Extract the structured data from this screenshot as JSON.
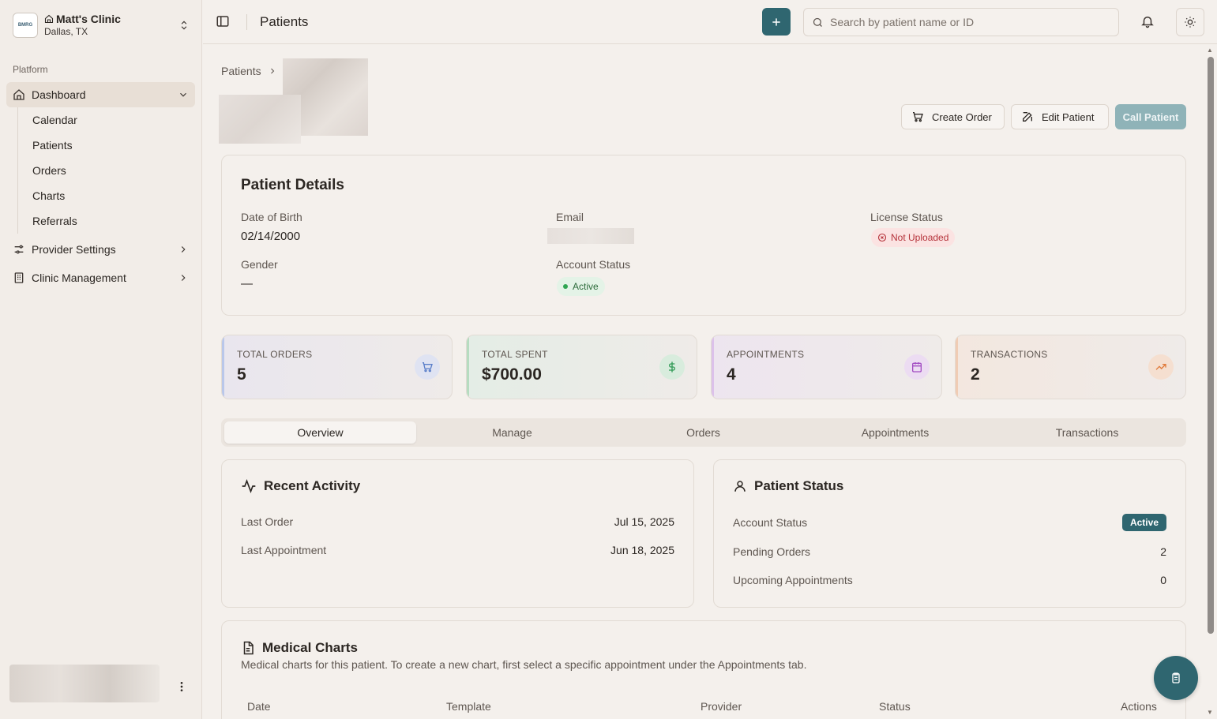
{
  "sidebar": {
    "clinic": {
      "logo_text": "BMRG",
      "name": "Matt's Clinic",
      "location": "Dallas, TX"
    },
    "section_label": "Platform",
    "nav": {
      "dashboard": "Dashboard",
      "sub_items": [
        "Calendar",
        "Patients",
        "Orders",
        "Charts",
        "Referrals"
      ],
      "provider_settings": "Provider Settings",
      "clinic_management": "Clinic Management"
    }
  },
  "header": {
    "title": "Patients",
    "search_placeholder": "Search by patient name or ID"
  },
  "breadcrumb": {
    "root": "Patients"
  },
  "actions": {
    "create_order": "Create Order",
    "edit_patient": "Edit Patient",
    "call_patient": "Call Patient"
  },
  "patient_details": {
    "title": "Patient Details",
    "dob_label": "Date of Birth",
    "dob": "02/14/2000",
    "email_label": "Email",
    "license_label": "License Status",
    "license_status": "Not Uploaded",
    "gender_label": "Gender",
    "gender": "—",
    "account_status_label": "Account Status",
    "account_status": "Active"
  },
  "stats": [
    {
      "label": "TOTAL ORDERS",
      "value": "5",
      "icon": "cart-icon",
      "color": "#5b7fc9"
    },
    {
      "label": "TOTAL SPENT",
      "value": "$700.00",
      "icon": "dollar-icon",
      "color": "#2f9a55"
    },
    {
      "label": "APPOINTMENTS",
      "value": "4",
      "icon": "calendar-icon",
      "color": "#a24cc2"
    },
    {
      "label": "TRANSACTIONS",
      "value": "2",
      "icon": "trending-up-icon",
      "color": "#e07a3a"
    }
  ],
  "tabs": [
    "Overview",
    "Manage",
    "Orders",
    "Appointments",
    "Transactions"
  ],
  "recent_activity": {
    "title": "Recent Activity",
    "last_order_label": "Last Order",
    "last_order": "Jul 15, 2025",
    "last_appointment_label": "Last Appointment",
    "last_appointment": "Jun 18, 2025"
  },
  "patient_status": {
    "title": "Patient Status",
    "account_status_label": "Account Status",
    "account_status": "Active",
    "pending_orders_label": "Pending Orders",
    "pending_orders": "2",
    "upcoming_label": "Upcoming Appointments",
    "upcoming": "0"
  },
  "medical_charts": {
    "title": "Medical Charts",
    "subtitle": "Medical charts for this patient. To create a new chart, first select a specific appointment under the Appointments tab.",
    "columns": [
      "Date",
      "Template",
      "Provider",
      "Status",
      "Actions"
    ]
  },
  "colors": {
    "primary": "#2f6670",
    "background": "#f4f0ec"
  }
}
